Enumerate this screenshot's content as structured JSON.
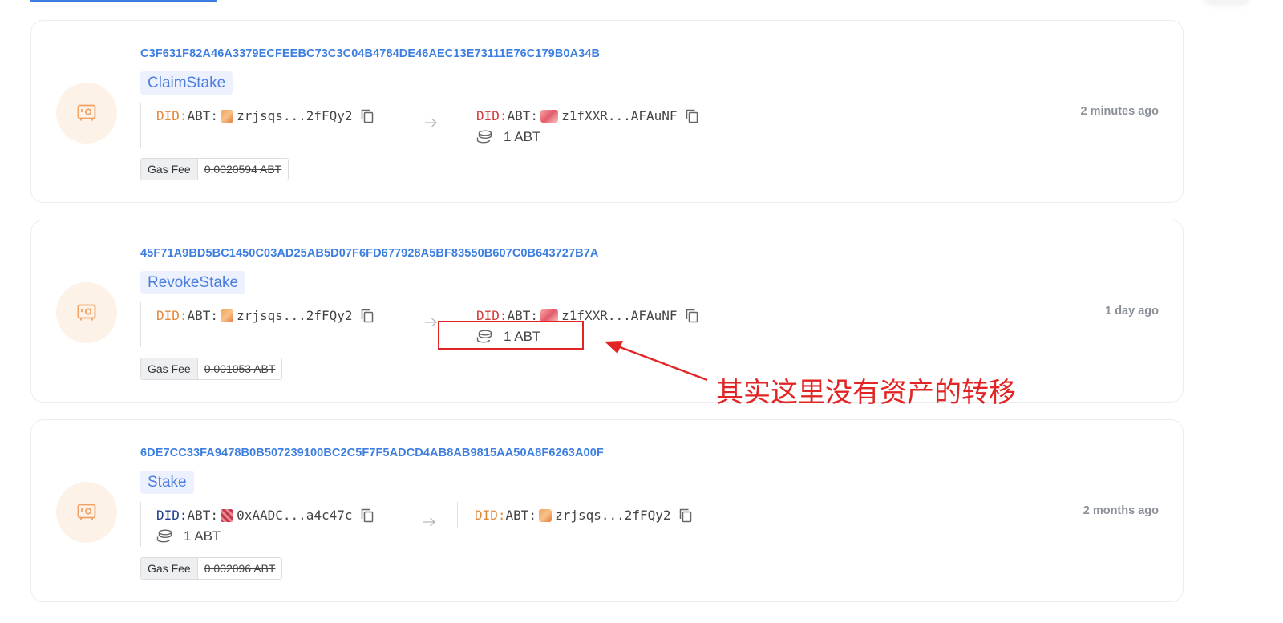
{
  "colors": {
    "accent": "#3d7fe0",
    "did_prefix": "#e2883b",
    "annotation": "#e12525",
    "icon_bg": "#fdf2e8",
    "icon": "#f0a060"
  },
  "icons": {
    "tx": "safe-icon",
    "copy": "copy-icon",
    "arrow": "arrow-right-icon",
    "coins": "coins-icon"
  },
  "transactions": [
    {
      "hash": "C3F631F82A46A3379ECFEEBC73C3C04B4784DE46AEC13E73111E76C179B0A34B",
      "type": "ClaimStake",
      "from": {
        "did_prefix": "DID:",
        "chain": "ABT:",
        "addr": "zrjsqs...2fFQy2"
      },
      "to": {
        "did_prefix": "DID:",
        "chain": "ABT:",
        "addr": "z1fXXR...AFAuNF"
      },
      "amount": "1 ABT",
      "time": "2 minutes ago",
      "gas_label": "Gas Fee",
      "gas_value": "0.0020594 ABT"
    },
    {
      "hash": "45F71A9BD5BC1450C03AD25AB5D07F6FD677928A5BF83550B607C0B643727B7A",
      "type": "RevokeStake",
      "from": {
        "did_prefix": "DID:",
        "chain": "ABT:",
        "addr": "zrjsqs...2fFQy2"
      },
      "to": {
        "did_prefix": "DID:",
        "chain": "ABT:",
        "addr": "z1fXXR...AFAuNF"
      },
      "amount": "1 ABT",
      "time": "1 day ago",
      "gas_label": "Gas Fee",
      "gas_value": "0.001053 ABT"
    },
    {
      "hash": "6DE7CC33FA9478B0B507239100BC2C5F7F5ADCD4AB8AB9815AA50A8F6263A00F",
      "type": "Stake",
      "from": {
        "did_prefix": "DID:",
        "chain": "ABT:",
        "addr": "0xAADC...a4c47c"
      },
      "to": {
        "did_prefix": "DID:",
        "chain": "ABT:",
        "addr": "zrjsqs...2fFQy2"
      },
      "amount": "1 ABT",
      "time": "2 months ago",
      "gas_label": "Gas Fee",
      "gas_value": "0.002096 ABT"
    }
  ],
  "annotation": {
    "text": "其实这里没有资产的转移"
  }
}
